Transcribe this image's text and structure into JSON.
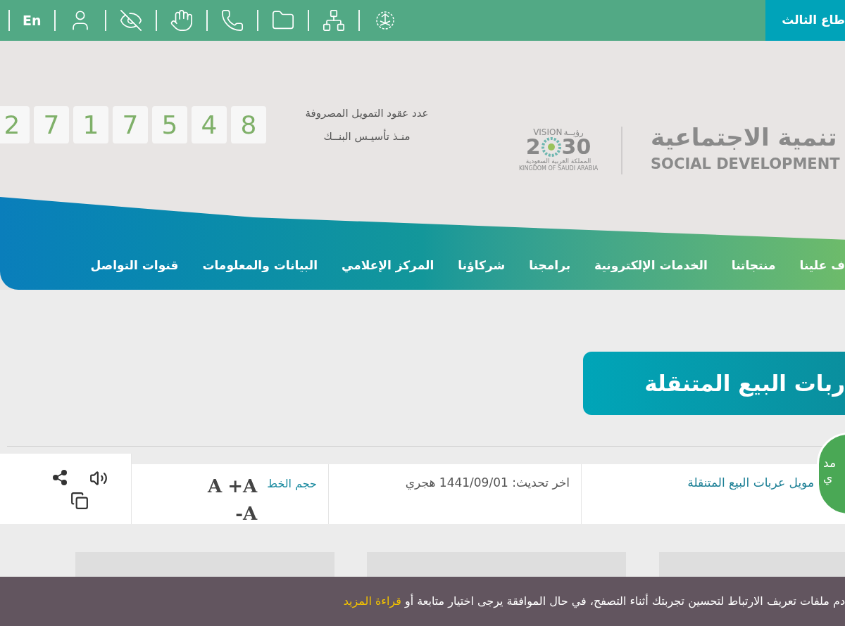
{
  "top_bar": {
    "sector_tab": "طاع الثالث",
    "language": "En"
  },
  "header": {
    "counter": {
      "label_lines": [
        "عدد عقود التمويل المصروفة",
        "منـذ تأسيـس البنــك"
      ],
      "digits": [
        "8",
        "4",
        "5",
        "7",
        "1",
        "7",
        "2"
      ]
    },
    "vision_logo": {
      "word": "VISION",
      "word_ar": "رؤيــة",
      "year_start": "2",
      "year_end": "30",
      "country_ar": "المملكة العربية السعودية",
      "country": "KINGDOM OF SAUDI ARABIA"
    },
    "ministry_logo": {
      "arabic": "تنمية الاجتماعية",
      "english": "SOCIAL DEVELOPMENT"
    }
  },
  "nav": [
    {
      "label": "ف علينا"
    },
    {
      "label": "منتجاتنا"
    },
    {
      "label": "الخدمات الإلكترونية"
    },
    {
      "label": "برامجنا"
    },
    {
      "label": "شركاؤنا"
    },
    {
      "label": "المركز الإعلامي"
    },
    {
      "label": "البيانات والمعلومات"
    },
    {
      "label": "قنوات التواصل"
    }
  ],
  "page_title": "ربات البيع المتنقلة",
  "info_bar": {
    "breadcrumb": "مويل عربات البيع المتنقلة",
    "updated": "اخر تحديث: 1441/09/01 هجري",
    "font_size_label": "حجم الخط",
    "font_buttons": [
      "A",
      "+A",
      "-A"
    ]
  },
  "chat_bubble": [
    "مد",
    "ي"
  ],
  "cookie_bar": {
    "text": "دم ملفات تعريف الارتباط لتحسين تجربتك أثناء التصفح، في حال الموافقة يرجى اختيار متابعة أو",
    "link": "قراءة المزيد"
  }
}
